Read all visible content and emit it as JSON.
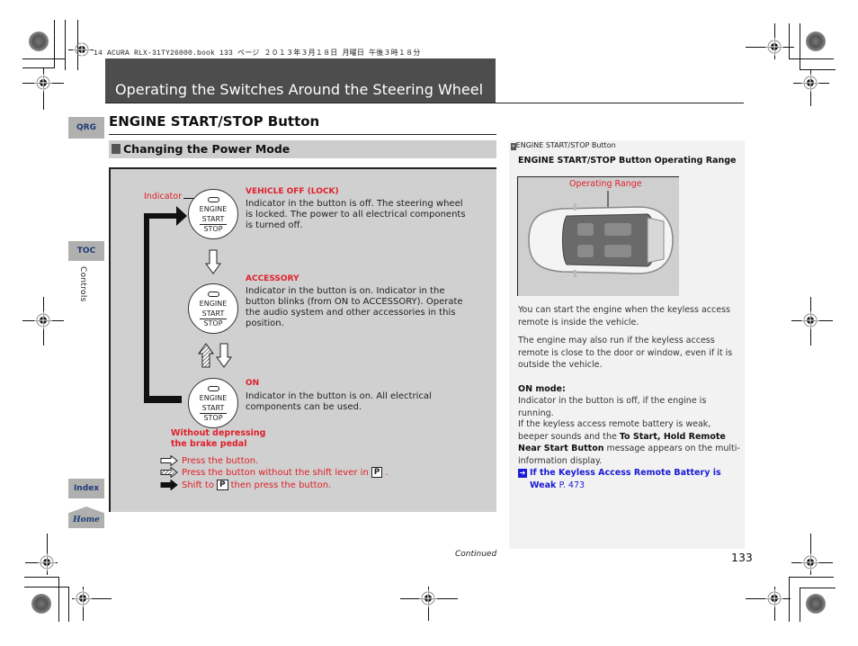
{
  "print_header": "14 ACURA RLX-31TY26000.book  133 ページ  ２０１３年３月１８日  月曜日  午後３時１８分",
  "chapter": {
    "title": "Operating the Switches Around the Steering Wheel"
  },
  "nav": {
    "qrg": "QRG",
    "toc": "TOC",
    "section_label": "Controls",
    "index": "Index",
    "home": "Home"
  },
  "section": {
    "title": "ENGINE START/STOP Button",
    "subsection": "Changing the Power Mode"
  },
  "diagram": {
    "indicator_label": "Indicator",
    "button_text": {
      "line1": "ENGINE",
      "line2": "START",
      "line3": "STOP"
    },
    "modes": [
      {
        "title": "VEHICLE OFF (LOCK)",
        "description": "Indicator in the button is off. The steering wheel is locked. The power to all electrical components is turned off."
      },
      {
        "title": "ACCESSORY",
        "description": "Indicator in the button is on. Indicator in the button blinks (from ON to ACCESSORY). Operate the audio system and other accessories in this position."
      },
      {
        "title": "ON",
        "description": "Indicator in the button is on. All electrical components can be used."
      }
    ],
    "brake_note": "Without depressing the brake pedal",
    "legend": [
      {
        "icon": "white-arrow-icon",
        "before": "Press the button.",
        "after": ""
      },
      {
        "icon": "hatched-arrow-icon",
        "before": "Press the button without the shift lever in",
        "after": "."
      },
      {
        "icon": "black-arrow-icon",
        "before": "Shift to",
        "after": "then press the button."
      }
    ],
    "park_symbol": "P"
  },
  "sidebar": {
    "ref_label": "ENGINE START/STOP Button",
    "heading": "ENGINE START/STOP Button Operating Range",
    "image_label": "Operating Range",
    "para1": "You can start the engine when the keyless access remote is inside the vehicle.",
    "para2": "The engine may also run if the keyless access remote is close to the door or window, even if it is outside the vehicle.",
    "on_mode_title": "ON mode:",
    "on_mode_text": "Indicator in the button is off, if the engine is running.",
    "para4_a": "If the keyless access remote battery is weak, beeper sounds and the ",
    "para4_bold": "To Start, Hold Remote Near Start Button",
    "para4_b": " message appears on the multi-information display.",
    "link_text": "If the Keyless Access Remote Battery is Weak",
    "link_page": "P. 473"
  },
  "footer": {
    "continued": "Continued",
    "page_number": "133"
  }
}
